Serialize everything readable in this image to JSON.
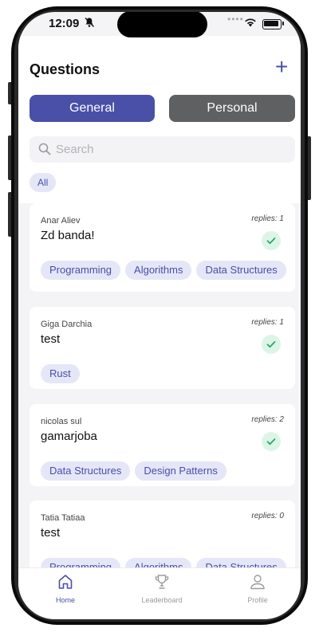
{
  "status": {
    "time": "12:09"
  },
  "header": {
    "title": "Questions",
    "add_symbol": "+"
  },
  "segments": {
    "general": "General",
    "personal": "Personal"
  },
  "search": {
    "placeholder": "Search"
  },
  "filter": {
    "all": "All"
  },
  "questions": [
    {
      "author": "Anar Aliev",
      "title": "Zd banda!",
      "replies": "replies: 1",
      "tags": [
        "Programming",
        "Algorithms",
        "Data Structures"
      ]
    },
    {
      "author": "Giga Darchia",
      "title": "test",
      "replies": "replies: 1",
      "tags": [
        "Rust"
      ]
    },
    {
      "author": "nicolas sul",
      "title": "gamarjoba",
      "replies": "replies: 2",
      "tags": [
        "Data Structures",
        "Design Patterns"
      ]
    },
    {
      "author": "Tatia Tatiaa",
      "title": "test",
      "replies": "replies: 0",
      "tags": [
        "Programming",
        "Algorithms",
        "Data Structures"
      ]
    }
  ],
  "tabbar": {
    "home": "Home",
    "leaderboard": "Leaderboard",
    "profile": "Profile"
  },
  "colors": {
    "accent": "#4a4fa8",
    "inactive": "#5f6061",
    "check_bg": "#dcf5e8",
    "check": "#2fa866"
  },
  "icons": [
    "bell-slash-icon",
    "wifi-icon",
    "battery-icon",
    "plus-icon",
    "search-icon",
    "check-icon",
    "home-icon",
    "trophy-icon",
    "profile-icon"
  ]
}
